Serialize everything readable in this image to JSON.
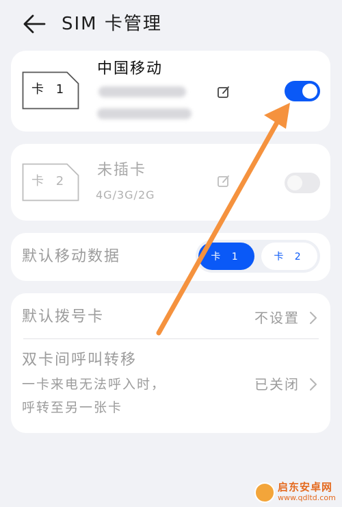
{
  "header": {
    "title": "SIM 卡管理",
    "back_icon": "arrow-left-icon"
  },
  "sim_cards": [
    {
      "slot_label": "卡 1",
      "name": "中国移动",
      "number_visible": false,
      "sub_visible": false,
      "enabled": true,
      "accent": "#0a59f7"
    },
    {
      "slot_label": "卡 2",
      "name": "未插卡",
      "network": "4G/3G/2G",
      "enabled": false
    }
  ],
  "default_data": {
    "label": "默认移动数据",
    "options": [
      "卡 1",
      "卡 2"
    ],
    "selected": "卡 1"
  },
  "settings": {
    "default_call_label": "默认拨号卡",
    "default_call_value": "不设置",
    "forwarding_title": "双卡间呼叫转移",
    "forwarding_desc_line1": "一卡来电无法呼入时，",
    "forwarding_desc_line2": "呼转至另一张卡",
    "forwarding_value": "已关闭"
  },
  "colors": {
    "accent": "#0a59f7",
    "annotation_arrow": "#f5923e",
    "background": "#f1f2f6",
    "card": "#ffffff"
  },
  "watermark": {
    "title": "启东安卓网",
    "url": "www.qdltd.com"
  }
}
